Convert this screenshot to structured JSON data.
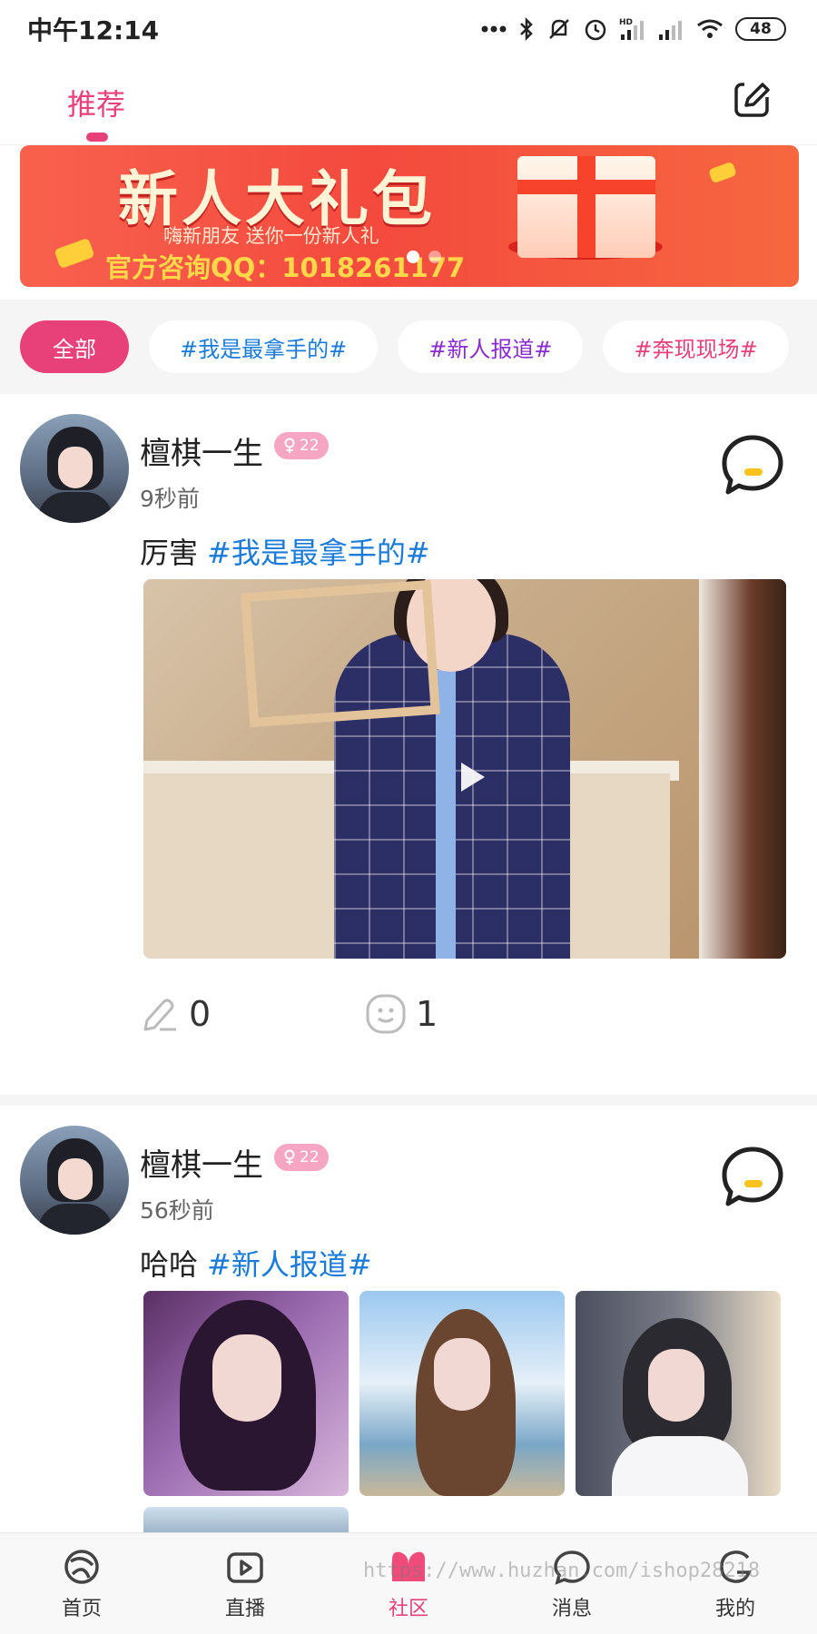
{
  "status_bar": {
    "time": "中午12:14",
    "battery": "48"
  },
  "header": {
    "tab_label": "推荐"
  },
  "banner": {
    "title": "新人大礼包",
    "subtitle": "嗨新朋友 送你一份新人礼",
    "contact": "官方咨询QQ：1018261177"
  },
  "chips": [
    "全部",
    "#我是最拿手的#",
    "#新人报道#",
    "#奔现现场#"
  ],
  "chip_colors": [
    "#ffffff",
    "#1a7bd9",
    "#8a2bd0",
    "#e8417a"
  ],
  "posts": [
    {
      "username": "檀棋一生",
      "badge": "22",
      "time": "9秒前",
      "text": "厉害",
      "tag": "#我是最拿手的#",
      "likes": "0",
      "comments": "1"
    },
    {
      "username": "檀棋一生",
      "badge": "22",
      "time": "56秒前",
      "text": "哈哈",
      "tag": "#新人报道#"
    }
  ],
  "nav": [
    "首页",
    "直播",
    "社区",
    "消息",
    "我的"
  ],
  "watermark": "https://www.huzhan.com/ishop28218",
  "colors": {
    "accent": "#e8417a",
    "tag_blue": "#1a7bd9"
  }
}
